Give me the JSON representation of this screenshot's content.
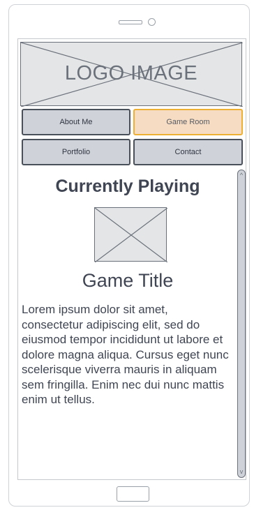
{
  "header": {
    "logo_text": "LOGO IMAGE"
  },
  "nav": {
    "about": "About Me",
    "game_room": "Game Room",
    "portfolio": "Portfolio",
    "contact": "Contact"
  },
  "main": {
    "section_title": "Currently Playing",
    "game_title": "Game Title",
    "description": "Lorem ipsum dolor sit amet, consectetur adipiscing elit, sed do eiusmod tempor incididunt ut labore et dolore magna aliqua. Cursus eget nunc scelerisque viverra mauris in aliquam sem fringilla. Enim nec dui nunc mattis enim ut tellus."
  },
  "colors": {
    "active_tab_border": "#eeb032",
    "active_tab_fill": "#f6dcc2",
    "tab_fill": "#cfd3d9",
    "text": "#3f4552"
  }
}
